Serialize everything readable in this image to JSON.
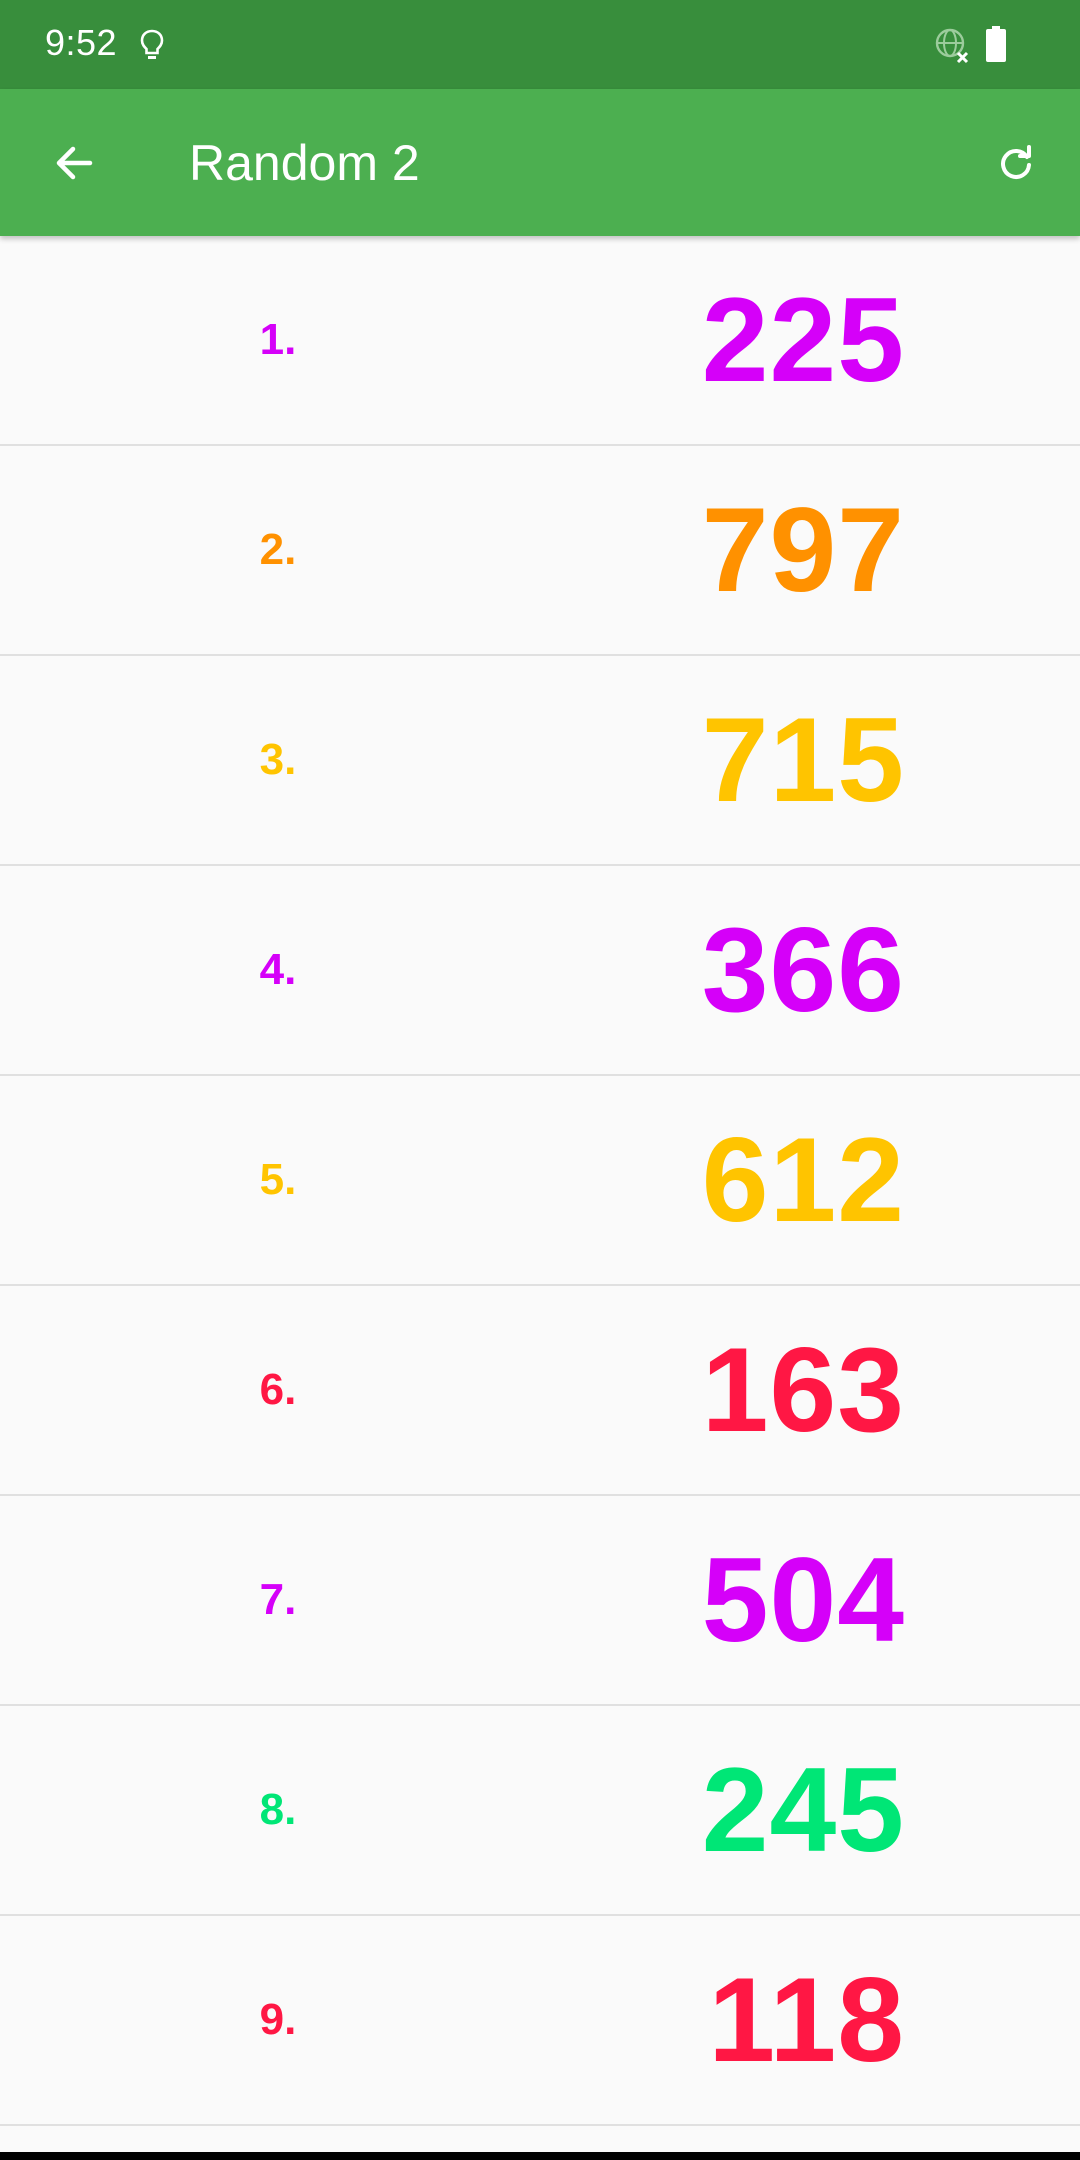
{
  "status_bar": {
    "time": "9:52",
    "icons": [
      "lightbulb-icon",
      "globe-off-icon",
      "battery-icon"
    ],
    "background": "#388e3c"
  },
  "app_bar": {
    "title": "Random 2",
    "background": "#4caf50",
    "back_icon": "arrow-left-icon",
    "refresh_icon": "refresh-icon"
  },
  "list": {
    "items": [
      {
        "index": "1.",
        "value": "225",
        "color": "#d500f9"
      },
      {
        "index": "2.",
        "value": "797",
        "color": "#ff9100"
      },
      {
        "index": "3.",
        "value": "715",
        "color": "#ffc400"
      },
      {
        "index": "4.",
        "value": "366",
        "color": "#d500f9"
      },
      {
        "index": "5.",
        "value": "612",
        "color": "#ffc400"
      },
      {
        "index": "6.",
        "value": "163",
        "color": "#ff1744"
      },
      {
        "index": "7.",
        "value": "504",
        "color": "#d500f9"
      },
      {
        "index": "8.",
        "value": "245",
        "color": "#00e676"
      },
      {
        "index": "9.",
        "value": "118",
        "color": "#ff1744"
      }
    ]
  }
}
